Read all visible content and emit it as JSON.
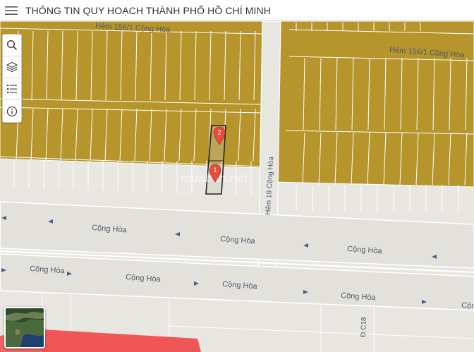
{
  "header": {
    "title": "THÔNG TIN QUY HOẠCH THÀNH PHỐ HỒ CHÍ MINH"
  },
  "toolbar": {
    "buttons": [
      "search-icon",
      "layers-icon",
      "legend-list-icon",
      "info-icon"
    ]
  },
  "map": {
    "street_labels": {
      "cong_hoa": "Cộng Hòa",
      "hem_156_1": "Hẻm 156/1 Cộng Hòa",
      "hem_156_1_top": "Hẻm 156/1 Cộng Hòa",
      "hem_19": "Hẻm 19 Cộng Hòa",
      "d_c18": "Đ.C18"
    },
    "markers": [
      {
        "label": "1"
      },
      {
        "label": "2"
      }
    ],
    "watermark": "muaban.net",
    "colors": {
      "residential_land": "#b5952c",
      "road": "#e8e6e1",
      "commercial": "#f05656",
      "marker": "#e74c3c",
      "parcel_outline": "#222222"
    }
  }
}
